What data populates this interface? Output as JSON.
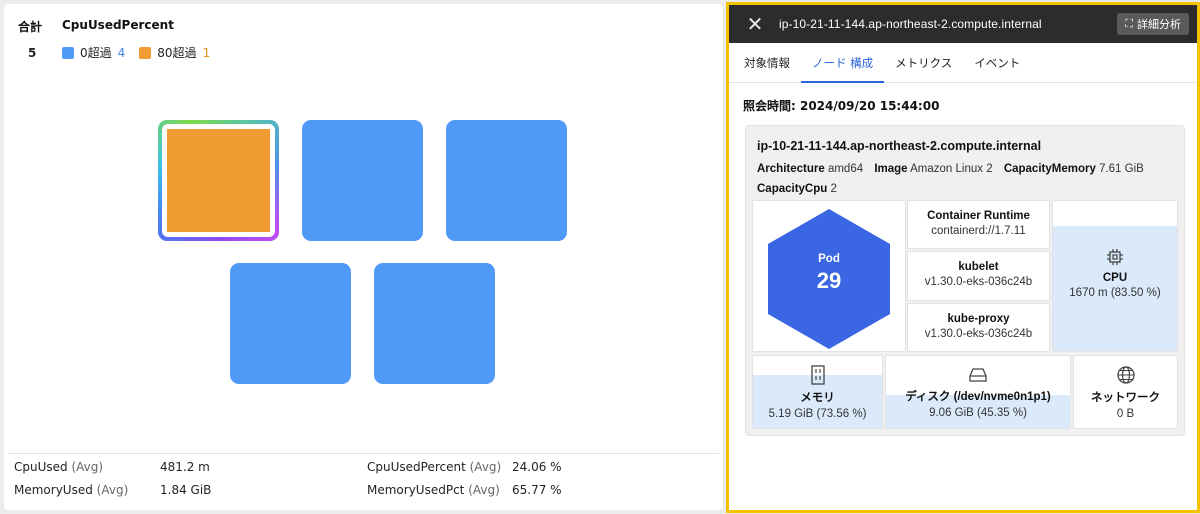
{
  "summary": {
    "total_label": "合計",
    "metric_label": "CpuUsedPercent",
    "total": "5",
    "legend": [
      {
        "label": "0超過",
        "count": "4",
        "color": "#5199f7",
        "count_color": "#3f86ea"
      },
      {
        "label": "80超過",
        "count": "1",
        "color": "#f09c33",
        "count_color": "#e59117"
      }
    ]
  },
  "tiles": [
    {
      "status": "80超過",
      "color": "#f09c33",
      "selected": true
    },
    {
      "status": "0超過",
      "color": "#5199f7"
    },
    {
      "status": "0超過",
      "color": "#5199f7"
    },
    {
      "status": "0超過",
      "color": "#5199f7"
    },
    {
      "status": "0超過",
      "color": "#5199f7"
    }
  ],
  "stats": [
    {
      "name": "CpuUsed",
      "unit": "(Avg)",
      "value": "481.2 m"
    },
    {
      "name": "MemoryUsed",
      "unit": "(Avg)",
      "value": "1.84 GiB"
    },
    {
      "name": "CpuUsedPercent",
      "unit": "(Avg)",
      "value": "24.06 %"
    },
    {
      "name": "MemoryUsedPct",
      "unit": "(Avg)",
      "value": "65.77 %"
    }
  ],
  "panel": {
    "title": "ip-10-21-11-144.ap-northeast-2.compute.internal",
    "detail_button": "詳細分析",
    "tabs": [
      "対象情報",
      "ノード 構成",
      "メトリクス",
      "イベント"
    ],
    "active_tab": 1,
    "query_time": "照会時間: 2024/09/20 15:44:00"
  },
  "node": {
    "name": "ip-10-21-11-144.ap-northeast-2.compute.internal",
    "props": [
      {
        "key": "Architecture",
        "value": "amd64"
      },
      {
        "key": "Image",
        "value": "Amazon Linux 2"
      },
      {
        "key": "CapacityMemory",
        "value": "7.61 GiB"
      },
      {
        "key": "CapacityCpu",
        "value": "2"
      }
    ],
    "pod": {
      "label": "Pod",
      "count": "29",
      "color": "#3a66e3"
    },
    "container_runtime": {
      "title": "Container Runtime",
      "value": "containerd://1.7.11"
    },
    "kubelet": {
      "title": "kubelet",
      "value": "v1.30.0-eks-036c24b"
    },
    "kube_proxy": {
      "title": "kube-proxy",
      "value": "v1.30.0-eks-036c24b"
    },
    "cpu": {
      "title": "CPU",
      "value": "1670 m (83.50 %)",
      "percent": 83.5,
      "icon": "cpu-chip-icon"
    },
    "memory": {
      "title": "メモリ",
      "value": "5.19 GiB (73.56 %)",
      "percent": 73.56,
      "icon": "memory-icon"
    },
    "disk": {
      "title": "ディスク (/dev/nvme0n1p1)",
      "value": "9.06 GiB (45.35 %)",
      "percent": 45.35,
      "icon": "disk-icon"
    },
    "network": {
      "title": "ネットワーク",
      "value": "0 B",
      "icon": "globe-icon"
    }
  }
}
